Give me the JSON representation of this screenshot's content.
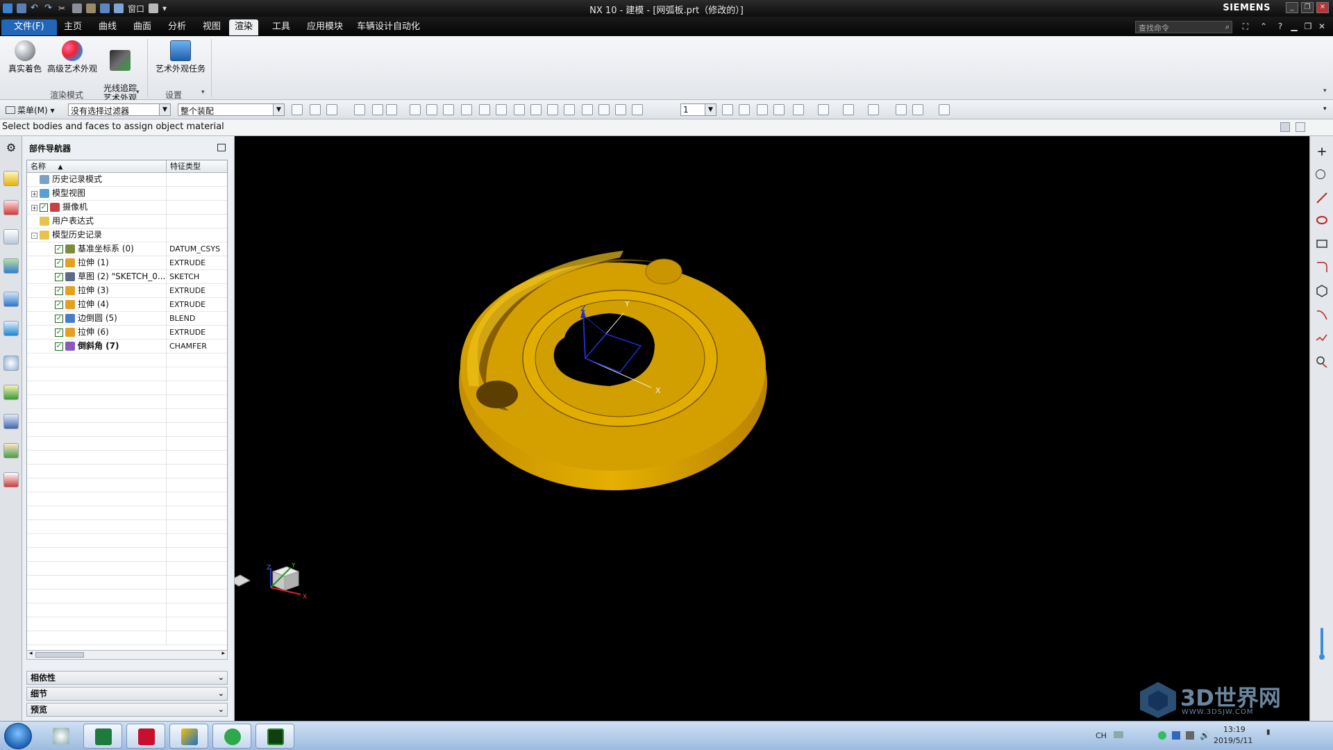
{
  "titlebar": {
    "title": "NX 10 - 建模 - [网弧板.prt（修改的）]",
    "brand": "SIEMENS",
    "quick_access_window": "窗口"
  },
  "menu_tabs": {
    "file": "文件(F)",
    "items": [
      "主页",
      "曲线",
      "曲面",
      "分析",
      "视图",
      "渲染",
      "工具",
      "应用模块",
      "车辆设计自动化"
    ],
    "active": "渲染"
  },
  "command_search": {
    "placeholder": "查找命令"
  },
  "ribbon": {
    "buttons": [
      {
        "label": "真实着色",
        "icon": "true-shading-icon"
      },
      {
        "label": "高级艺术外观",
        "icon": "advanced-studio-icon"
      },
      {
        "label": "光线追踪\n艺术外观",
        "icon": "ray-traced-studio-icon"
      },
      {
        "label": "艺术外观任务",
        "icon": "studio-task-icon"
      }
    ],
    "groups": [
      "渲染模式",
      "设置"
    ]
  },
  "toolbar": {
    "menu_label": "菜单(M)",
    "selection_filter": "没有选择过滤器",
    "selection_scope": "整个装配",
    "layer_value": "1"
  },
  "cue_line": "Select bodies and faces to assign object material",
  "navigator": {
    "title": "部件导航器",
    "columns": [
      "名称",
      "特征类型"
    ],
    "rows": [
      {
        "label": "历史记录模式",
        "type": "",
        "indent": 0,
        "expander": "",
        "check": false,
        "icon": "clock-icon"
      },
      {
        "label": "模型视图",
        "type": "",
        "indent": 0,
        "expander": "+",
        "check": false,
        "icon": "model-views-icon"
      },
      {
        "label": "摄像机",
        "type": "",
        "indent": 0,
        "expander": "+",
        "check": true,
        "icon": "camera-icon"
      },
      {
        "label": "用户表达式",
        "type": "",
        "indent": 0,
        "expander": "",
        "check": false,
        "icon": "folder-icon"
      },
      {
        "label": "模型历史记录",
        "type": "",
        "indent": 0,
        "expander": "-",
        "check": false,
        "icon": "folder-open-icon"
      },
      {
        "label": "基准坐标系 (0)",
        "type": "DATUM_CSYS",
        "indent": 1,
        "expander": "",
        "check": true,
        "icon": "datum-csys-icon"
      },
      {
        "label": "拉伸 (1)",
        "type": "EXTRUDE",
        "indent": 1,
        "expander": "",
        "check": true,
        "icon": "extrude-icon"
      },
      {
        "label": "草图 (2) \"SKETCH_0...",
        "type": "SKETCH",
        "indent": 1,
        "expander": "",
        "check": true,
        "icon": "sketch-icon"
      },
      {
        "label": "拉伸 (3)",
        "type": "EXTRUDE",
        "indent": 1,
        "expander": "",
        "check": true,
        "icon": "extrude-icon"
      },
      {
        "label": "拉伸 (4)",
        "type": "EXTRUDE",
        "indent": 1,
        "expander": "",
        "check": true,
        "icon": "extrude-icon"
      },
      {
        "label": "边倒圆 (5)",
        "type": "BLEND",
        "indent": 1,
        "expander": "",
        "check": true,
        "icon": "blend-icon"
      },
      {
        "label": "拉伸 (6)",
        "type": "EXTRUDE",
        "indent": 1,
        "expander": "",
        "check": true,
        "icon": "extrude-icon"
      },
      {
        "label": "倒斜角 (7)",
        "type": "CHAMFER",
        "indent": 1,
        "expander": "",
        "check": true,
        "icon": "chamfer-icon",
        "bold": true
      }
    ],
    "panels": [
      "相依性",
      "细节",
      "预览"
    ]
  },
  "graphics": {
    "part_color": "#d4a000",
    "triad_labels": [
      "Z",
      "Y",
      "X"
    ],
    "view_triad_labels": [
      "Z",
      "Y",
      "X"
    ]
  },
  "watermark": {
    "text": "3D世界网",
    "url_text": "WWW.3DSJW.COM"
  },
  "taskbar": {
    "tray_lang": "CH",
    "time": "13:19",
    "date": "2019/5/11"
  }
}
